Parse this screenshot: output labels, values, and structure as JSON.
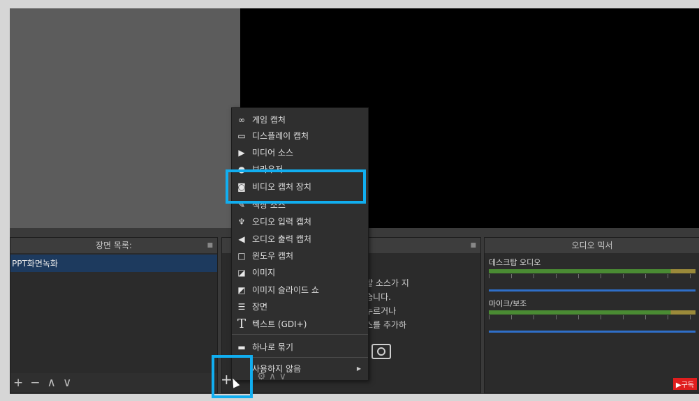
{
  "scenes": {
    "title": "장면 목록:",
    "items": [
      "PPT화면녹화"
    ],
    "toolbar": [
      "+",
      "−",
      "∧",
      "∨"
    ]
  },
  "sources": {
    "hint_lines": [
      "할 소스가 지",
      "습니다.",
      "누르거나",
      "스를 추가하"
    ]
  },
  "mixer": {
    "title": "오디오 믹서",
    "channels": [
      {
        "name": "데스크탑 오디오"
      },
      {
        "name": "마이크/보조"
      }
    ],
    "badge": "▶구독"
  },
  "context_menu": {
    "items": [
      {
        "label": "게임 캡처",
        "icon": "gamepad-icon"
      },
      {
        "label": "디스플레이 캡처",
        "icon": "monitor-icon"
      },
      {
        "label": "미디어 소스",
        "icon": "play-icon"
      },
      {
        "label": "브라우저",
        "icon": "globe-icon"
      },
      {
        "label": "비디오 캡처 장치",
        "icon": "camera-icon"
      },
      {
        "label": "색상 소스",
        "icon": "brush-icon"
      },
      {
        "label": "오디오 입력 캡처",
        "icon": "microphone-icon"
      },
      {
        "label": "오디오 출력 캡처",
        "icon": "speaker-icon"
      },
      {
        "label": "윈도우 캡처",
        "icon": "window-icon"
      },
      {
        "label": "이미지",
        "icon": "image-icon"
      },
      {
        "label": "이미지 슬라이드 쇼",
        "icon": "slideshow-icon"
      },
      {
        "label": "장면",
        "icon": "list-icon"
      },
      {
        "label": "텍스트 (GDI+)",
        "icon": "text-icon"
      },
      {
        "label": "하나로 묶기",
        "icon": "folder-icon"
      },
      {
        "label": "사용하지 않음",
        "icon": ""
      }
    ]
  },
  "highlight_color": "#11aef0",
  "add_source_label": "+"
}
